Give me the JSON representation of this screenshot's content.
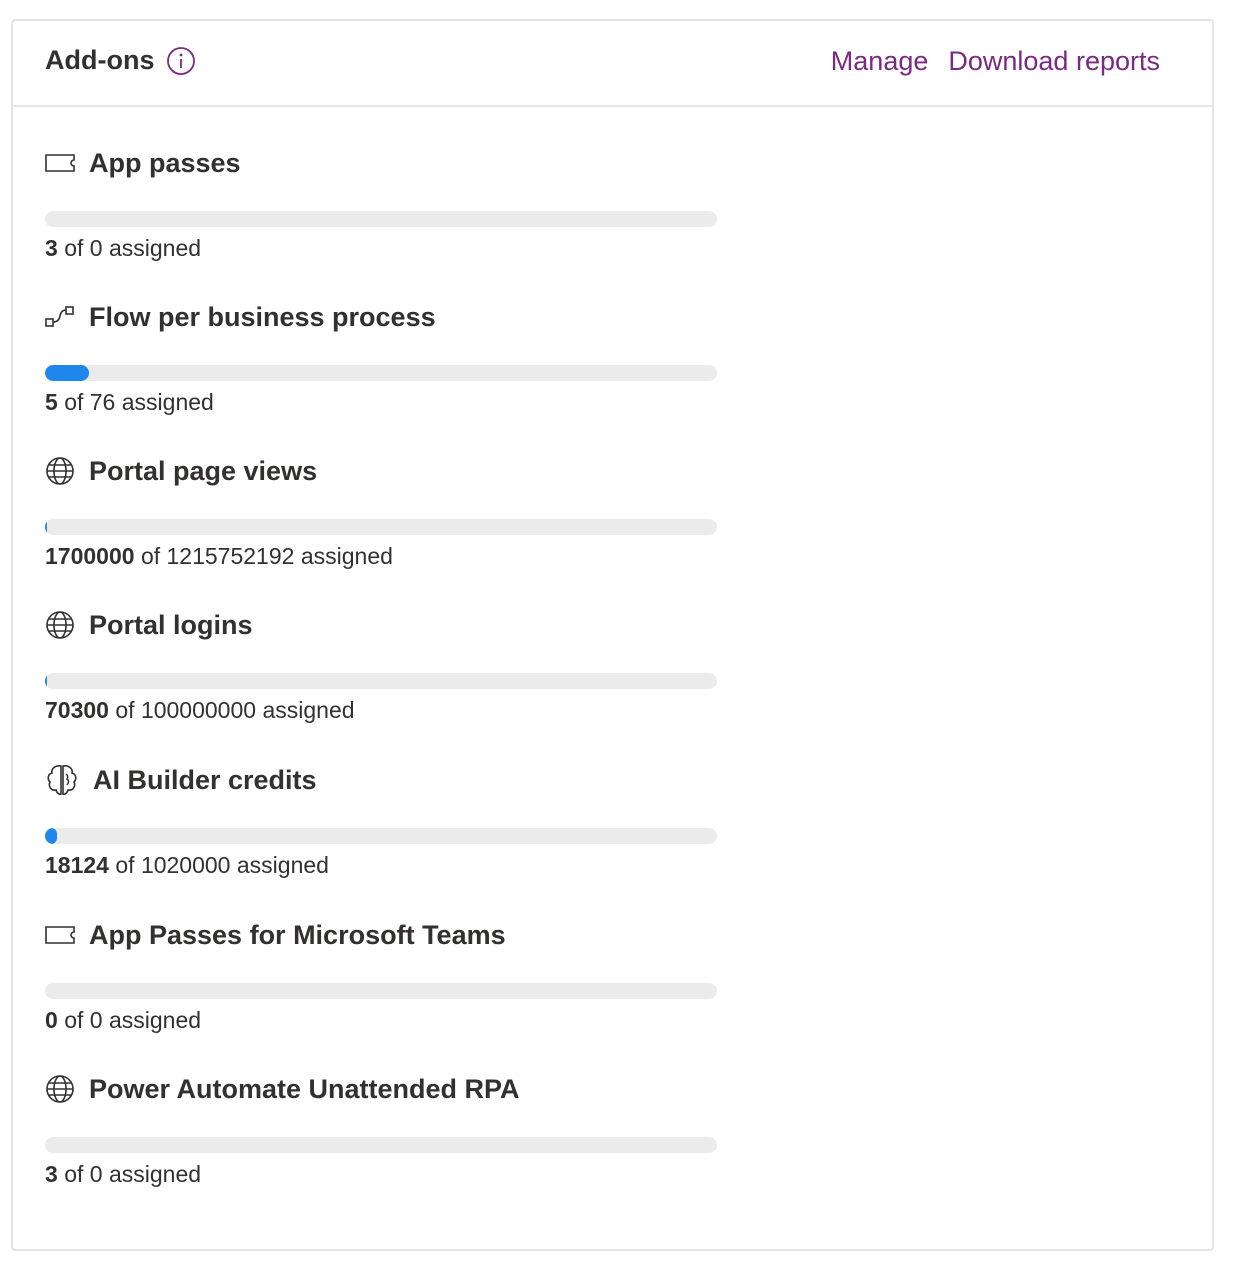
{
  "header": {
    "title": "Add-ons",
    "manage_label": "Manage",
    "download_label": "Download reports",
    "link_color": "#7a2a82",
    "info_icon": "info-icon"
  },
  "accent_color": "#1f86ec",
  "addons": [
    {
      "name": "App passes",
      "icon": "ticket-icon",
      "used": "3",
      "of_text": "of",
      "total": "0",
      "suffix": "assigned",
      "progress": 0
    },
    {
      "name": "Flow per business process",
      "icon": "flow-icon",
      "used": "5",
      "of_text": "of",
      "total": "76",
      "suffix": "assigned",
      "progress": 0.066
    },
    {
      "name": "Portal page views",
      "icon": "globe-icon",
      "used": "1700000",
      "of_text": "of",
      "total": "1215752192",
      "suffix": "assigned",
      "progress": 0.0014
    },
    {
      "name": "Portal logins",
      "icon": "globe-icon",
      "used": "70300",
      "of_text": "of",
      "total": "100000000",
      "suffix": "assigned",
      "progress": 0.0007
    },
    {
      "name": "AI Builder credits",
      "icon": "brain-icon",
      "used": "18124",
      "of_text": "of",
      "total": "1020000",
      "suffix": "assigned",
      "progress": 0.0178
    },
    {
      "name": "App Passes for Microsoft Teams",
      "icon": "ticket-icon",
      "used": "0",
      "of_text": "of",
      "total": "0",
      "suffix": "assigned",
      "progress": 0
    },
    {
      "name": "Power Automate Unattended RPA",
      "icon": "globe-icon",
      "used": "3",
      "of_text": "of",
      "total": "0",
      "suffix": "assigned",
      "progress": 0
    }
  ]
}
